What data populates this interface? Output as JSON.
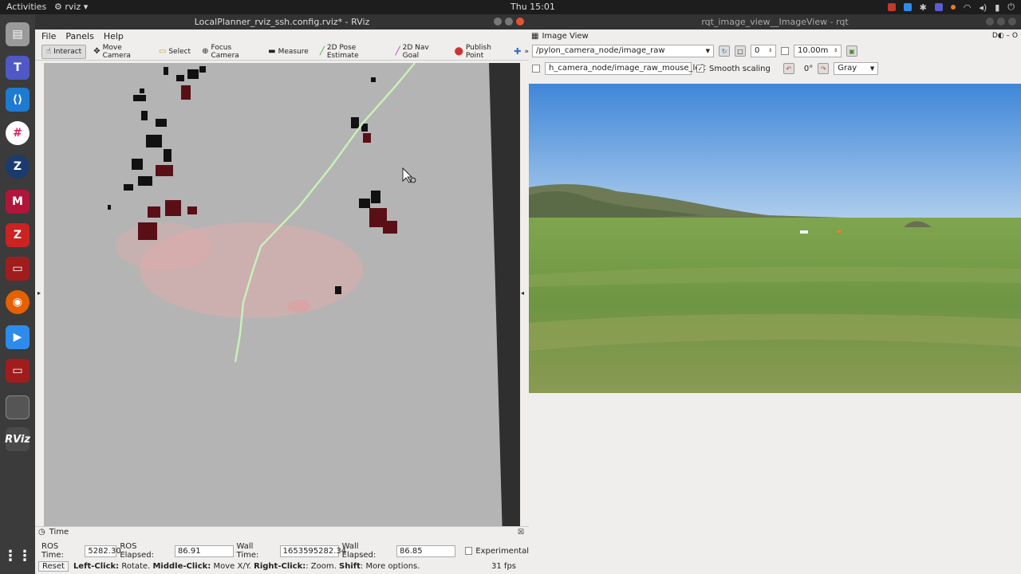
{
  "topbar": {
    "activities": "Activities",
    "app": "rviz",
    "clock": "Thu 15:01"
  },
  "dock": {
    "icons": [
      "files-icon",
      "teams-icon",
      "vscode-icon",
      "slack-icon",
      "zoom-z-icon",
      "mendeley-icon",
      "zotero-icon",
      "terminal-icon",
      "firefox-icon",
      "zoom-icon",
      "terminal2-icon",
      "window-icon",
      "rviz-icon",
      "app-grid-icon"
    ],
    "rviz_label": "RViz"
  },
  "rviz": {
    "title": "LocalPlanner_rviz_ssh.config.rviz* - RViz",
    "menu": [
      "File",
      "Panels",
      "Help"
    ],
    "tools": [
      {
        "label": "Interact",
        "icon": "hand-icon"
      },
      {
        "label": "Move Camera",
        "icon": "move-icon"
      },
      {
        "label": "Select",
        "icon": "select-icon"
      },
      {
        "label": "Focus Camera",
        "icon": "focus-icon"
      },
      {
        "label": "Measure",
        "icon": "ruler-icon"
      },
      {
        "label": "2D Pose Estimate",
        "icon": "arrow-green-icon"
      },
      {
        "label": "2D Nav Goal",
        "icon": "arrow-purple-icon"
      },
      {
        "label": "Publish Point",
        "icon": "pin-icon"
      }
    ],
    "time": {
      "panel_title": "Time",
      "ros_time_label": "ROS Time:",
      "ros_time": "5282.30",
      "ros_elapsed_label": "ROS Elapsed:",
      "ros_elapsed": "86.91",
      "wall_time_label": "Wall Time:",
      "wall_time": "1653595282.34",
      "wall_elapsed_label": "Wall Elapsed:",
      "wall_elapsed": "86.85",
      "experimental": "Experimental"
    },
    "status": {
      "reset": "Reset",
      "left_click": "Left-Click:",
      "left_text": "Rotate.",
      "middle_click": "Middle-Click:",
      "middle_text": "Move X/Y.",
      "right_click": "Right-Click:",
      "right_text": ": Zoom.",
      "shift": "Shift",
      "shift_text": ": More options.",
      "fps": "31 fps"
    }
  },
  "rqt": {
    "title": "rqt_image_view__ImageView - rqt",
    "panel_title": "Image View",
    "topic": "/pylon_camera_node/image_raw",
    "spin_value": "0",
    "max_range": "10.00m",
    "mouse_topic": "h_camera_node/image_raw_mouse_left",
    "smooth_scaling": "Smooth scaling",
    "rotation": "0°",
    "color_scheme": "Gray"
  }
}
